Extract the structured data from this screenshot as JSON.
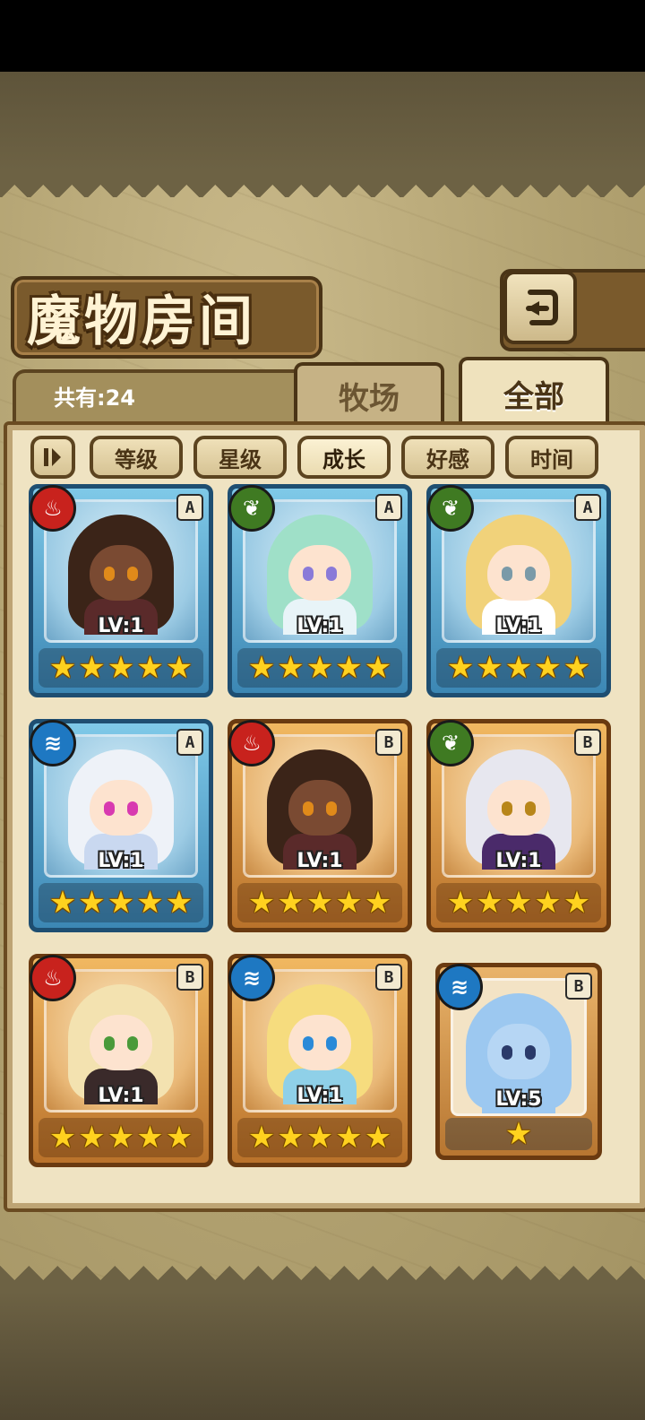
{
  "page": {
    "title": "魔物房间",
    "count_label": "共有:24"
  },
  "tabs": [
    {
      "label": "牧场",
      "active": false
    },
    {
      "label": "全部",
      "active": true
    }
  ],
  "filters": [
    {
      "label": "等级",
      "active": false
    },
    {
      "label": "星级",
      "active": false
    },
    {
      "label": "成长",
      "active": true
    },
    {
      "label": "好感",
      "active": false
    },
    {
      "label": "时间",
      "active": false
    }
  ],
  "icons": {
    "back": "back-arrow-icon",
    "sort_toggle": "sort-toggle-icon"
  },
  "colors": {
    "fire": "#c8221d",
    "leaf": "#3f7a22",
    "water": "#1e78c2",
    "rank_a_frame": "#3c87b4",
    "rank_b_frame": "#b9722b"
  },
  "monsters": [
    {
      "element": "fire",
      "rank": "A",
      "level": "LV:1",
      "stars": 5,
      "hair": "#3b2418",
      "skin": "#7a4a32",
      "eyes": "#e08a1a",
      "outfit": "#5a2a2a"
    },
    {
      "element": "leaf",
      "rank": "A",
      "level": "LV:1",
      "stars": 5,
      "hair": "#9fe0c8",
      "skin": "#fde3cf",
      "eyes": "#8a7ad8",
      "outfit": "#e8f4f8"
    },
    {
      "element": "leaf",
      "rank": "A",
      "level": "LV:1",
      "stars": 5,
      "hair": "#f1d27a",
      "skin": "#fde3cf",
      "eyes": "#7a9aa8",
      "outfit": "#ffffff"
    },
    {
      "element": "water",
      "rank": "A",
      "level": "LV:1",
      "stars": 5,
      "hair": "#eef2f8",
      "skin": "#fde3cf",
      "eyes": "#d83ab0",
      "outfit": "#c9d8f0"
    },
    {
      "element": "fire",
      "rank": "B",
      "level": "LV:1",
      "stars": 5,
      "hair": "#3b2418",
      "skin": "#7a4a32",
      "eyes": "#e08a1a",
      "outfit": "#5a2a2a"
    },
    {
      "element": "leaf",
      "rank": "B",
      "level": "LV:1",
      "stars": 5,
      "hair": "#e7e7ef",
      "skin": "#fde3cf",
      "eyes": "#b8861a",
      "outfit": "#4a2a6a"
    },
    {
      "element": "fire",
      "rank": "B",
      "level": "LV:1",
      "stars": 5,
      "hair": "#f3e2b0",
      "skin": "#fde3cf",
      "eyes": "#4a9a3a",
      "outfit": "#3a2a2a"
    },
    {
      "element": "water",
      "rank": "B",
      "level": "LV:1",
      "stars": 5,
      "hair": "#f6dc7e",
      "skin": "#fde3cf",
      "eyes": "#2a8ad8",
      "outfit": "#8fd0e8"
    },
    {
      "element": "water",
      "rank": "B",
      "level": "LV:5",
      "stars": 1,
      "hair": "#9cc8f0",
      "skin": "#b6d6f4",
      "eyes": "#2a3a6a",
      "outfit": "#9cc8f0",
      "slime": true
    }
  ]
}
